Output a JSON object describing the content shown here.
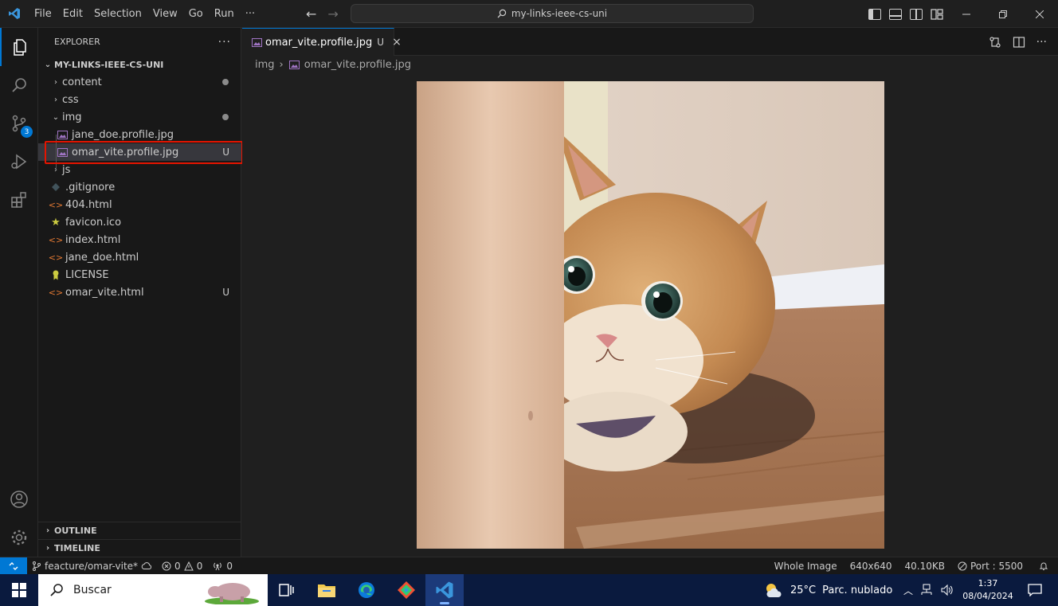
{
  "titlebar": {
    "menu": [
      "File",
      "Edit",
      "Selection",
      "View",
      "Go",
      "Run",
      "···"
    ],
    "search_text": "my-links-ieee-cs-uni"
  },
  "activitybar": {
    "source_control_badge": "3"
  },
  "explorer": {
    "header": "EXPLORER",
    "more": "···",
    "root": "MY-LINKS-IEEE-CS-UNI",
    "items": [
      {
        "label": "content",
        "type": "folder",
        "expanded": false,
        "modified_dot": true
      },
      {
        "label": "css",
        "type": "folder",
        "expanded": false
      },
      {
        "label": "img",
        "type": "folder",
        "expanded": true,
        "modified_dot": true
      },
      {
        "label": "jane_doe.profile.jpg",
        "type": "image"
      },
      {
        "label": "omar_vite.profile.jpg",
        "type": "image",
        "status": "U",
        "selected": true
      },
      {
        "label": "js",
        "type": "folder",
        "expanded": false
      },
      {
        "label": ".gitignore",
        "type": "git"
      },
      {
        "label": "404.html",
        "type": "html"
      },
      {
        "label": "favicon.ico",
        "type": "star"
      },
      {
        "label": "index.html",
        "type": "html"
      },
      {
        "label": "jane_doe.html",
        "type": "html"
      },
      {
        "label": "LICENSE",
        "type": "license"
      },
      {
        "label": "omar_vite.html",
        "type": "html",
        "status": "U"
      }
    ],
    "outline": "OUTLINE",
    "timeline": "TIMELINE"
  },
  "editor": {
    "tab_label": "omar_vite.profile.jpg",
    "tab_status": "U",
    "tab_close": "×",
    "breadcrumb": [
      "img",
      "omar_vite.profile.jpg"
    ],
    "breadcrumb_sep": "›"
  },
  "statusbar": {
    "branch": "feacture/omar-vite*",
    "errors": "0",
    "warnings": "0",
    "ports": "0",
    "zoom": "Whole Image",
    "dimensions": "640x640",
    "filesize": "40.10KB",
    "port": "Port : 5500"
  },
  "taskbar": {
    "search": "Buscar",
    "weather_temp": "25°C",
    "weather_desc": "Parc. nublado",
    "time": "1:37",
    "date": "08/04/2024"
  },
  "colors": {
    "accent": "#0078d4",
    "highlight": "#e51400",
    "html_icon": "#e37933",
    "image_icon": "#a074c4"
  }
}
